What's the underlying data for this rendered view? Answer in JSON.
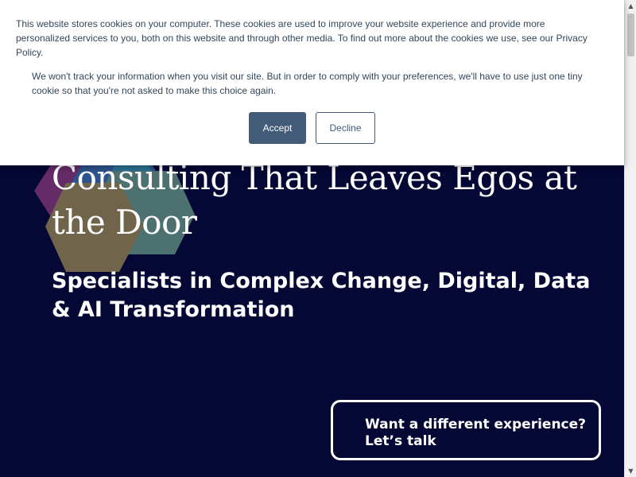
{
  "cookie_banner": {
    "message": "This website stores cookies on your computer. These cookies are used to improve your website experience and provide more personalized services to you, both on this website and through other media. To find out more about the cookies we use, see our Privacy Policy.",
    "secondary_message": "We won't track your information when you visit our site. But in order to comply with your preferences, we'll have to use just one tiny cookie so that you're not asked to make this choice again.",
    "accept_label": "Accept",
    "decline_label": "Decline"
  },
  "hero": {
    "title": "Consulting That Leaves Egos at the Door",
    "subtitle": "Specialists in Complex Change, Digital, Data & AI Transformation",
    "cta_line1": "Want a different experience?",
    "cta_line2": "Let’s talk"
  },
  "colors": {
    "hero_background": "#050734",
    "cookie_button": "#425b76",
    "cookie_text": "#33475b"
  },
  "icons": {
    "scroll_up": "triangle-up-icon",
    "scroll_down": "triangle-down-icon"
  }
}
